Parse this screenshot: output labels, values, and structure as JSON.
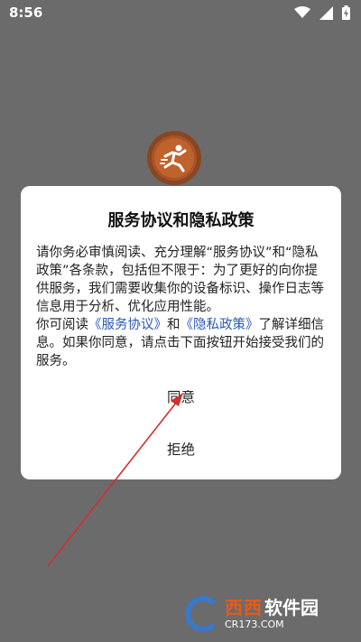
{
  "status_bar": {
    "time": "8:56"
  },
  "dialog": {
    "title": "服务协议和隐私政策",
    "body_line1": "请你务必审慎阅读、充分理解“服务协议”和“隐私政策”各条款，包括但不限于：为了更好的向你提供服务，我们需要收集你的设备标识、操作日志等信息用于分析、优化应用性能。",
    "body_prefix": "你可阅读",
    "link_service": "《服务协议》",
    "body_and": "和",
    "link_privacy": "《隐私政策》",
    "body_suffix": "了解详细信息。如果你同意，请点击下面按钮开始接受我们的服务。",
    "agree_label": "同意",
    "reject_label": "拒绝"
  },
  "watermark": {
    "brand": "西西",
    "soft": "软件园",
    "url": "CR173.COM"
  },
  "colors": {
    "background": "#6b6b6b",
    "link": "#2a59b5",
    "arrow": "#d0312d"
  },
  "icons": {
    "wifi": "wifi-icon",
    "cellular": "cellular-signal-icon",
    "battery": "battery-charging-icon",
    "app_logo": "app-logo-icon"
  }
}
